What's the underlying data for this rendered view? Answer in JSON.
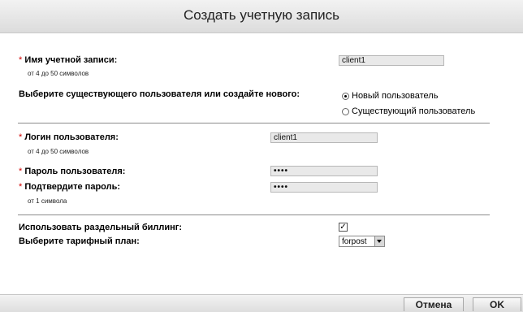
{
  "dialog": {
    "title": "Создать учетную запись"
  },
  "account": {
    "label": "Имя учетной записи:",
    "required_mark": "*",
    "hint": "от 4 до 50 символов",
    "value": "client1"
  },
  "user_choice": {
    "label": "Выберите существующего пользователя или создайте нового:",
    "options": [
      {
        "label": "Новый пользователь",
        "selected": true
      },
      {
        "label": "Существующий пользователь",
        "selected": false
      }
    ]
  },
  "login": {
    "label": "Логин пользователя:",
    "required_mark": "*",
    "hint": "от 4 до 50 символов",
    "value": "client1"
  },
  "password": {
    "label": "Пароль пользователя:",
    "required_mark": "*",
    "value": "••••"
  },
  "confirm": {
    "label": "Подтвердите пароль:",
    "required_mark": "*",
    "hint": "от 1 символа",
    "value": "••••"
  },
  "billing": {
    "label": "Использовать раздельный биллинг:",
    "checked": true,
    "check_glyph": "✓"
  },
  "tariff": {
    "label": "Выберите тарифный план:",
    "selected": "forpost"
  },
  "footer": {
    "cancel_label": "Отмена",
    "ok_label": "OK"
  }
}
